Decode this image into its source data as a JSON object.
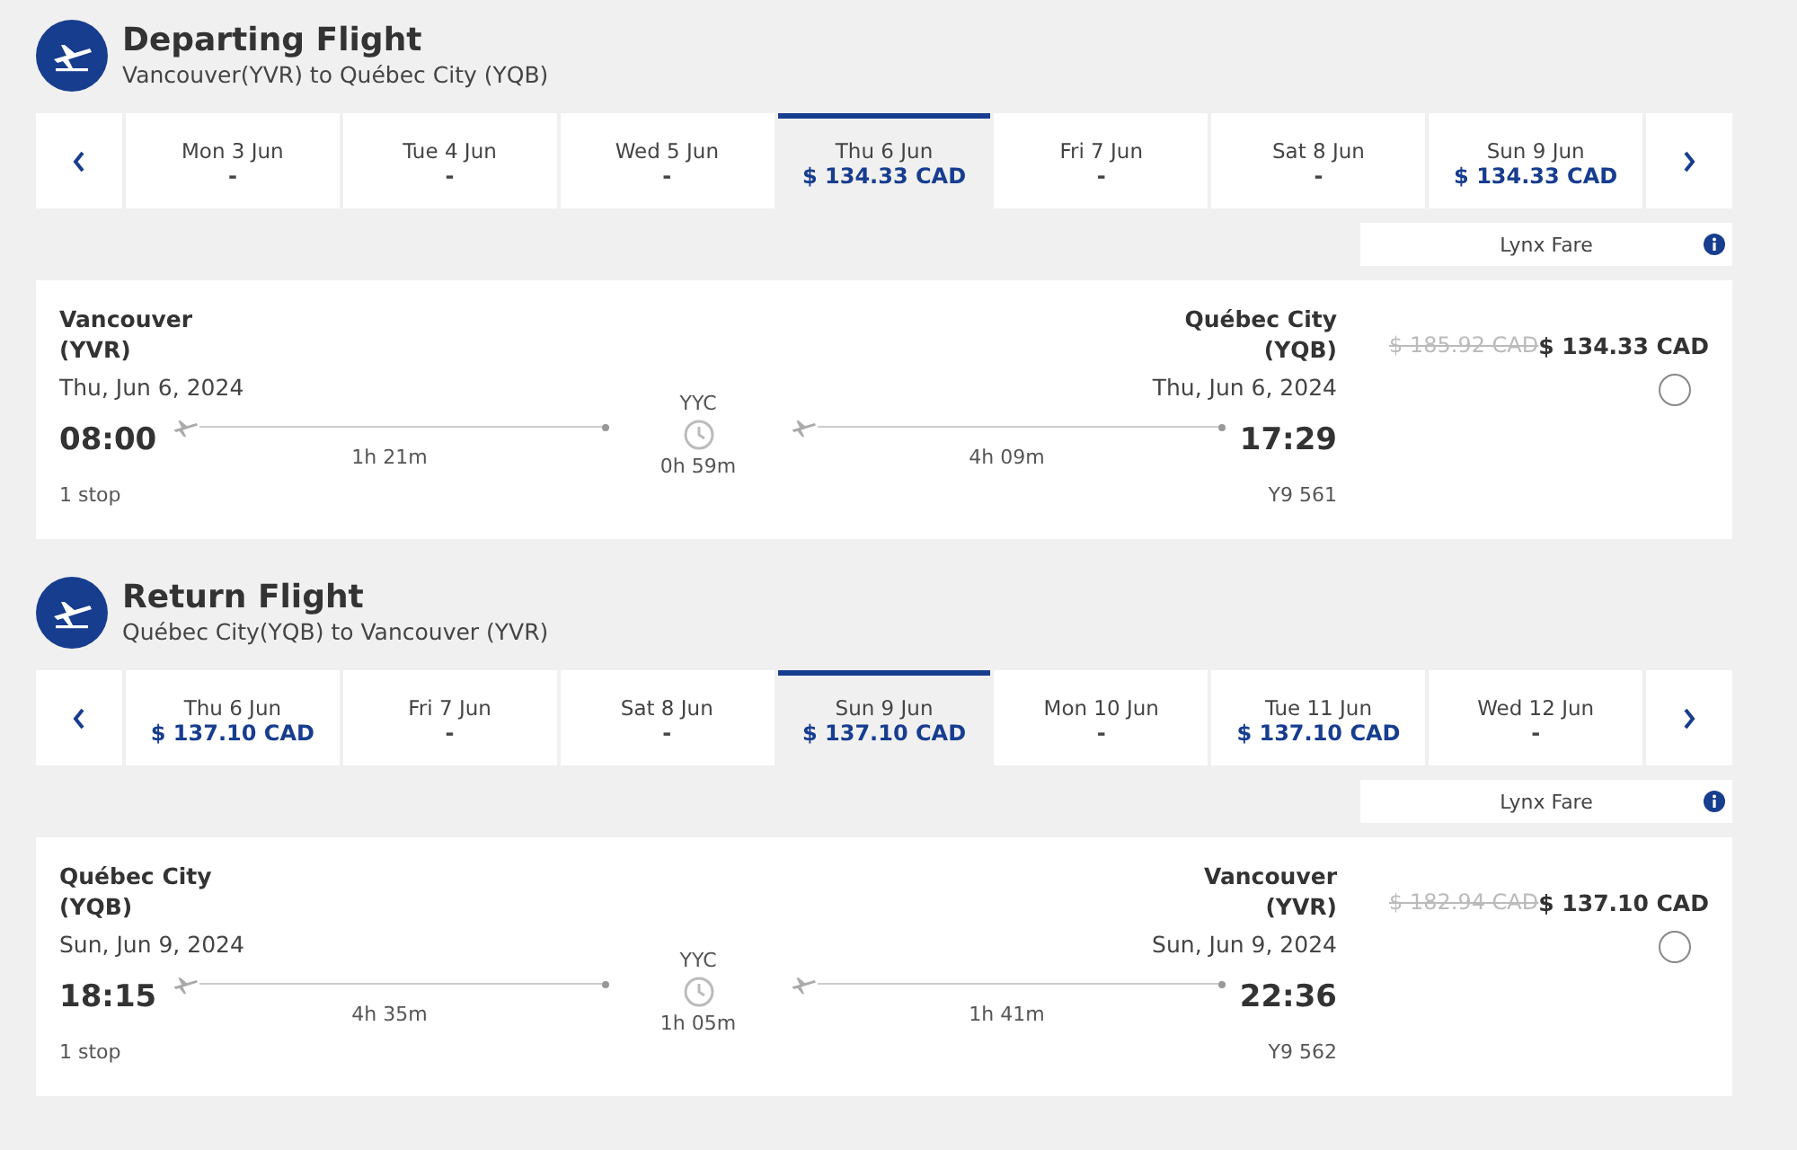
{
  "sections": [
    {
      "title": "Departing Flight",
      "route": "Vancouver(YVR) to Québec City (YQB)",
      "dates": [
        {
          "day": "Mon 3 Jun",
          "price": "-",
          "selected": false
        },
        {
          "day": "Tue 4 Jun",
          "price": "-",
          "selected": false
        },
        {
          "day": "Wed 5 Jun",
          "price": "-",
          "selected": false
        },
        {
          "day": "Thu 6 Jun",
          "price": "$ 134.33 CAD",
          "selected": true
        },
        {
          "day": "Fri 7 Jun",
          "price": "-",
          "selected": false
        },
        {
          "day": "Sat 8 Jun",
          "price": "-",
          "selected": false
        },
        {
          "day": "Sun 9 Jun",
          "price": "$ 134.33 CAD",
          "selected": false
        }
      ],
      "fare_label": "Lynx Fare",
      "flight": {
        "origin_city": "Vancouver",
        "origin_code": "(YVR)",
        "dest_city": "Québec City",
        "dest_code": "(YQB)",
        "depart_date": "Thu, Jun 6, 2024",
        "arrive_date": "Thu, Jun 6, 2024",
        "depart_time": "08:00",
        "arrive_time": "17:29",
        "leg1_duration": "1h 21m",
        "stop_code": "YYC",
        "layover": "0h 59m",
        "leg2_duration": "4h 09m",
        "stops": "1 stop",
        "flight_number": "Y9 561",
        "old_price": "$ 185.92 CAD",
        "price": "$ 134.33 CAD",
        "selected": false
      }
    },
    {
      "title": "Return Flight",
      "route": "Québec City(YQB) to Vancouver (YVR)",
      "dates": [
        {
          "day": "Thu 6 Jun",
          "price": "$ 137.10 CAD",
          "selected": false
        },
        {
          "day": "Fri 7 Jun",
          "price": "-",
          "selected": false
        },
        {
          "day": "Sat 8 Jun",
          "price": "-",
          "selected": false
        },
        {
          "day": "Sun 9 Jun",
          "price": "$ 137.10 CAD",
          "selected": true
        },
        {
          "day": "Mon 10 Jun",
          "price": "-",
          "selected": false
        },
        {
          "day": "Tue 11 Jun",
          "price": "$ 137.10 CAD",
          "selected": false
        },
        {
          "day": "Wed 12 Jun",
          "price": "-",
          "selected": false
        }
      ],
      "fare_label": "Lynx Fare",
      "flight": {
        "origin_city": "Québec City",
        "origin_code": "(YQB)",
        "dest_city": "Vancouver",
        "dest_code": "(YVR)",
        "depart_date": "Sun, Jun 9, 2024",
        "arrive_date": "Sun, Jun 9, 2024",
        "depart_time": "18:15",
        "arrive_time": "22:36",
        "leg1_duration": "4h 35m",
        "stop_code": "YYC",
        "layover": "1h 05m",
        "leg2_duration": "1h 41m",
        "stops": "1 stop",
        "flight_number": "Y9 562",
        "old_price": "$ 182.94 CAD",
        "price": "$ 137.10 CAD",
        "selected": false
      }
    }
  ]
}
